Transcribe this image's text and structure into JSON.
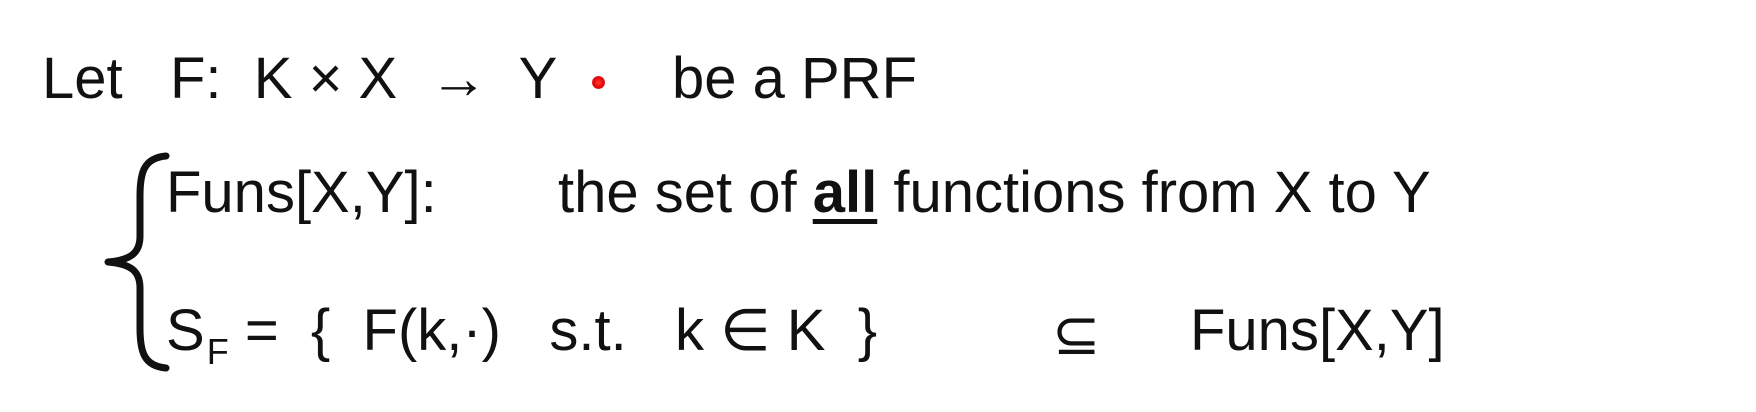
{
  "line1": {
    "let": "Let",
    "signature": "F:  K × X  →  Y",
    "suffix": "be a PRF"
  },
  "line2": {
    "term": "Funs[X,Y]:",
    "desc_prefix": "the set of",
    "desc_emphasis": "all",
    "desc_suffix": "functions from X to Y"
  },
  "line3": {
    "s": "S",
    "s_sub": "F",
    "set_def": "=  {  F(k,·)   s.t.   k ∈ K  }",
    "subseteq": "⊆",
    "funs": "Funs[X,Y]"
  },
  "colors": {
    "text": "#111111",
    "background": "#ffffff",
    "pointer": "#e10000"
  }
}
